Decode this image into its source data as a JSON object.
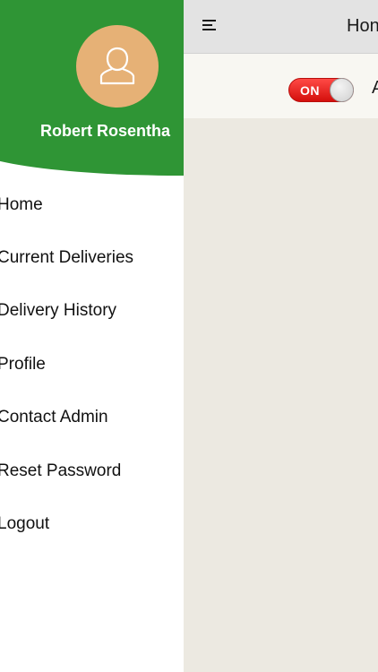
{
  "main": {
    "title": "Hon",
    "menu_icon": "menu-icon",
    "availability": {
      "toggle_label": "ON",
      "toggle_state": "on",
      "toggle_color": "#e3201d",
      "status_text": "A"
    }
  },
  "drawer": {
    "header_color": "#2f9535",
    "avatar_color": "#e6b176",
    "avatar_icon": "user-icon",
    "user_name": "Robert Rosentha",
    "items": [
      {
        "label": "Home"
      },
      {
        "label": "Current Deliveries"
      },
      {
        "label": "Delivery History"
      },
      {
        "label": "Profile"
      },
      {
        "label": "Contact Admin"
      },
      {
        "label": "Reset Password"
      },
      {
        "label": "Logout"
      }
    ]
  }
}
